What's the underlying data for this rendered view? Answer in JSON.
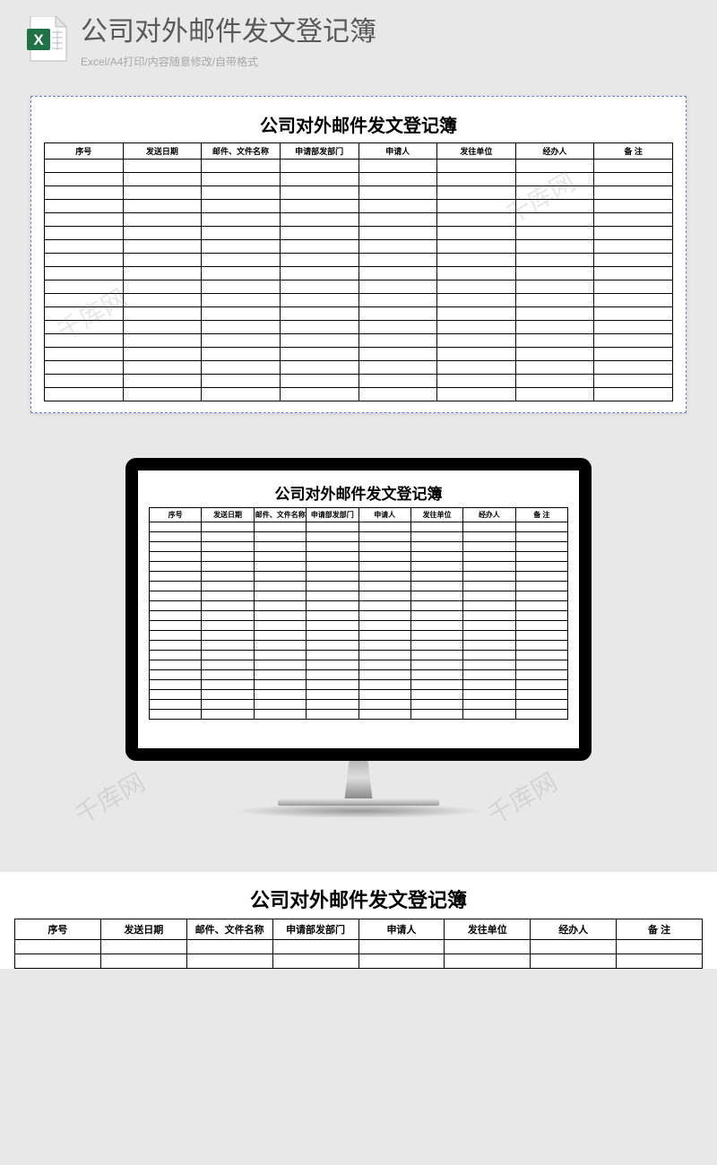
{
  "header": {
    "title": "公司对外邮件发文登记簿",
    "subtitle": "Excel/A4打印/内容随意修改/自带格式",
    "icon_text": "X"
  },
  "table": {
    "title": "公司对外邮件发文登记簿",
    "columns": [
      "序号",
      "发送日期",
      "邮件、文件名称",
      "申请部发部门",
      "申请人",
      "发往单位",
      "经办人",
      "备 注"
    ],
    "empty_rows": 18
  },
  "watermark_text": "千库网"
}
